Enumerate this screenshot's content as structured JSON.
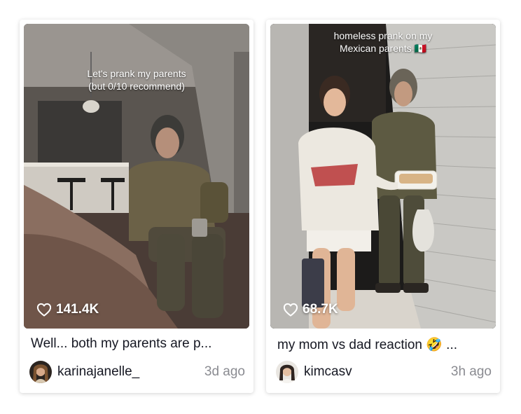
{
  "cards": [
    {
      "overlay_text": "Let's prank my parents\n(but 0/10 recommend)",
      "likes": "141.4K",
      "title": "Well... both my parents are p...",
      "username": "karinajanelle_",
      "time_ago": "3d ago"
    },
    {
      "overlay_text": "homeless prank on my\nMexican parents 🇲🇽",
      "likes": "68.7K",
      "title": "my mom vs dad reaction 🤣 ...",
      "username": "kimcasv",
      "time_ago": "3h ago"
    }
  ],
  "colors": {
    "text_primary": "#161823",
    "text_secondary": "#8a8b91",
    "overlay_text": "#ffffff"
  },
  "icons": {
    "likes": "heart-outline-icon"
  }
}
